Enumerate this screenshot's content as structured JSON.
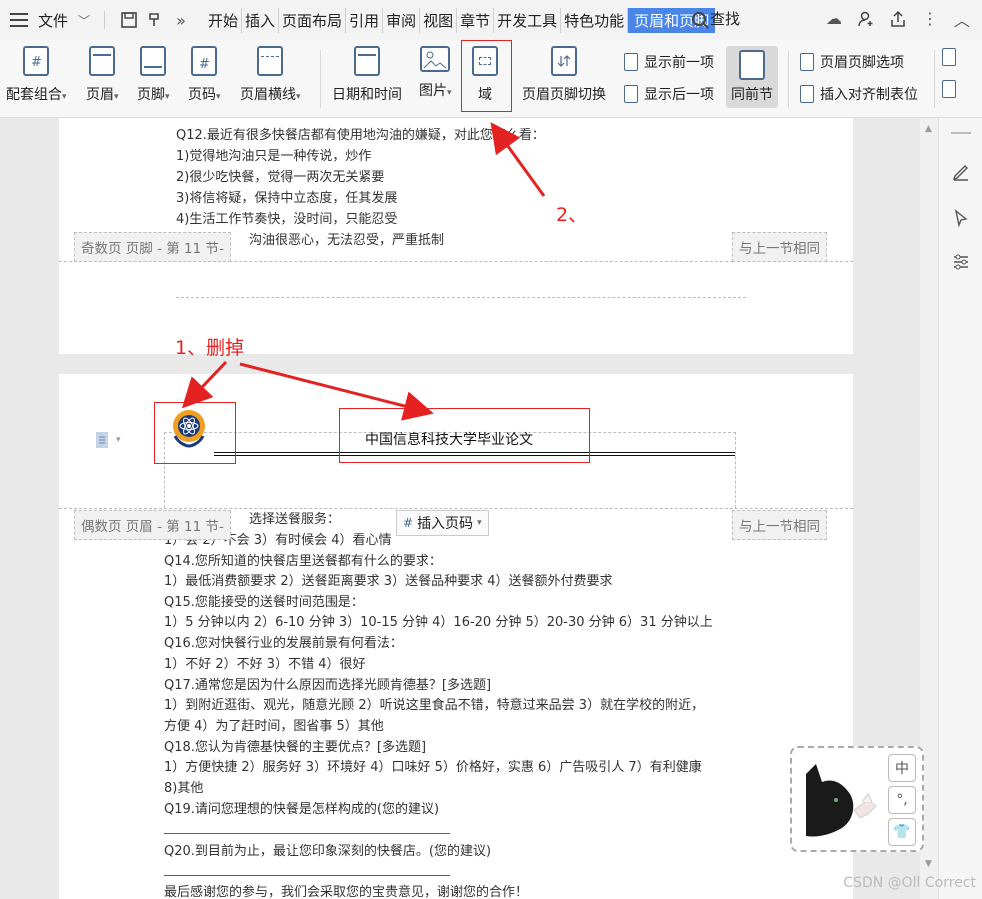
{
  "menubar": {
    "file_label": "文件",
    "tabs": [
      "开始",
      "插入",
      "页面布局",
      "引用",
      "审阅",
      "视图",
      "章节",
      "开发工具",
      "特色功能",
      "页眉和页脚"
    ],
    "search_label": "查找"
  },
  "ribbon": {
    "items": [
      "配套组合",
      "页眉",
      "页脚",
      "页码",
      "页眉横线",
      "日期和时间",
      "图片",
      "域",
      "页眉页脚切换",
      "同前节"
    ],
    "small_items": [
      "显示前一项",
      "显示后一项",
      "页眉页脚选项",
      "插入对齐制表位"
    ],
    "dropdown_marker": "▾"
  },
  "page1": {
    "lines": [
      "Q12.最近有很多快餐店都有使用地沟油的嫌疑，对此您怎么看：",
      "1)觉得地沟油只是一种传说，炒作",
      "2)很少吃快餐，觉得一两次无关紧要",
      "3)将信将疑，保持中立态度，任其发展",
      "4)生活工作节奏快，没时间，只能忍受",
      "沟油很恶心，无法忍受，严重抵制"
    ],
    "footer_tag": "奇数页 页脚 - 第 11 节-",
    "same_as_prev": "与上一节相同"
  },
  "page2": {
    "header_text": "中国信息科技大学毕业论文",
    "header_tag": "偶数页 页眉 - 第 11 节-",
    "same_as_prev": "与上一节相同",
    "insert_page_number": "插入页码",
    "lines": [
      "选择送餐服务：",
      "1）会 2）不会 3）有时候会 4）看心情",
      "Q14.您所知道的快餐店里送餐都有什么的要求：",
      "1）最低消费额要求 2）送餐距离要求 3）送餐品种要求 4）送餐额外付费要求",
      "Q15.您能接受的送餐时间范围是：",
      "1）5 分钟以内 2）6-10 分钟 3）10-15 分钟 4）16-20 分钟 5）20-30 分钟 6）31 分钟以上",
      "Q16.您对快餐行业的发展前景有何看法：",
      "1）不好 2）不好 3）不错 4）很好",
      "Q17.通常您是因为什么原因而选择光顾肯德基？[多选题]",
      "1）到附近逛街、观光，随意光顾 2）听说这里食品不错，特意过来品尝 3）就在学校的附近，",
      "方便 4）为了赶时间，图省事 5）其他",
      "Q18.您认为肯德基快餐的主要优点？[多选题]",
      "1）方便快捷 2）服务好 3）环境好 4）口味好 5）价格好，实惠 6）广告吸引人 7）有利健康",
      "8)其他",
      "Q19.请问您理想的快餐是怎样构成的(您的建议)",
      "____________________________________________",
      "Q20.到目前为止，最让您印象深刻的快餐店。(您的建议)",
      "____________________________________________",
      "最后感谢您的参与，我们会采取您的宝贵意见，谢谢您的合作！"
    ]
  },
  "annotations": {
    "step1": "1、删掉",
    "step2": "2、",
    "color": "#e52222"
  },
  "widget": {
    "buttons": [
      "中",
      "°,",
      "👕"
    ]
  },
  "watermark": "CSDN @Oll Correct",
  "colors": {
    "active_tab": "#4a86e8",
    "annotation_red": "#e52222"
  }
}
